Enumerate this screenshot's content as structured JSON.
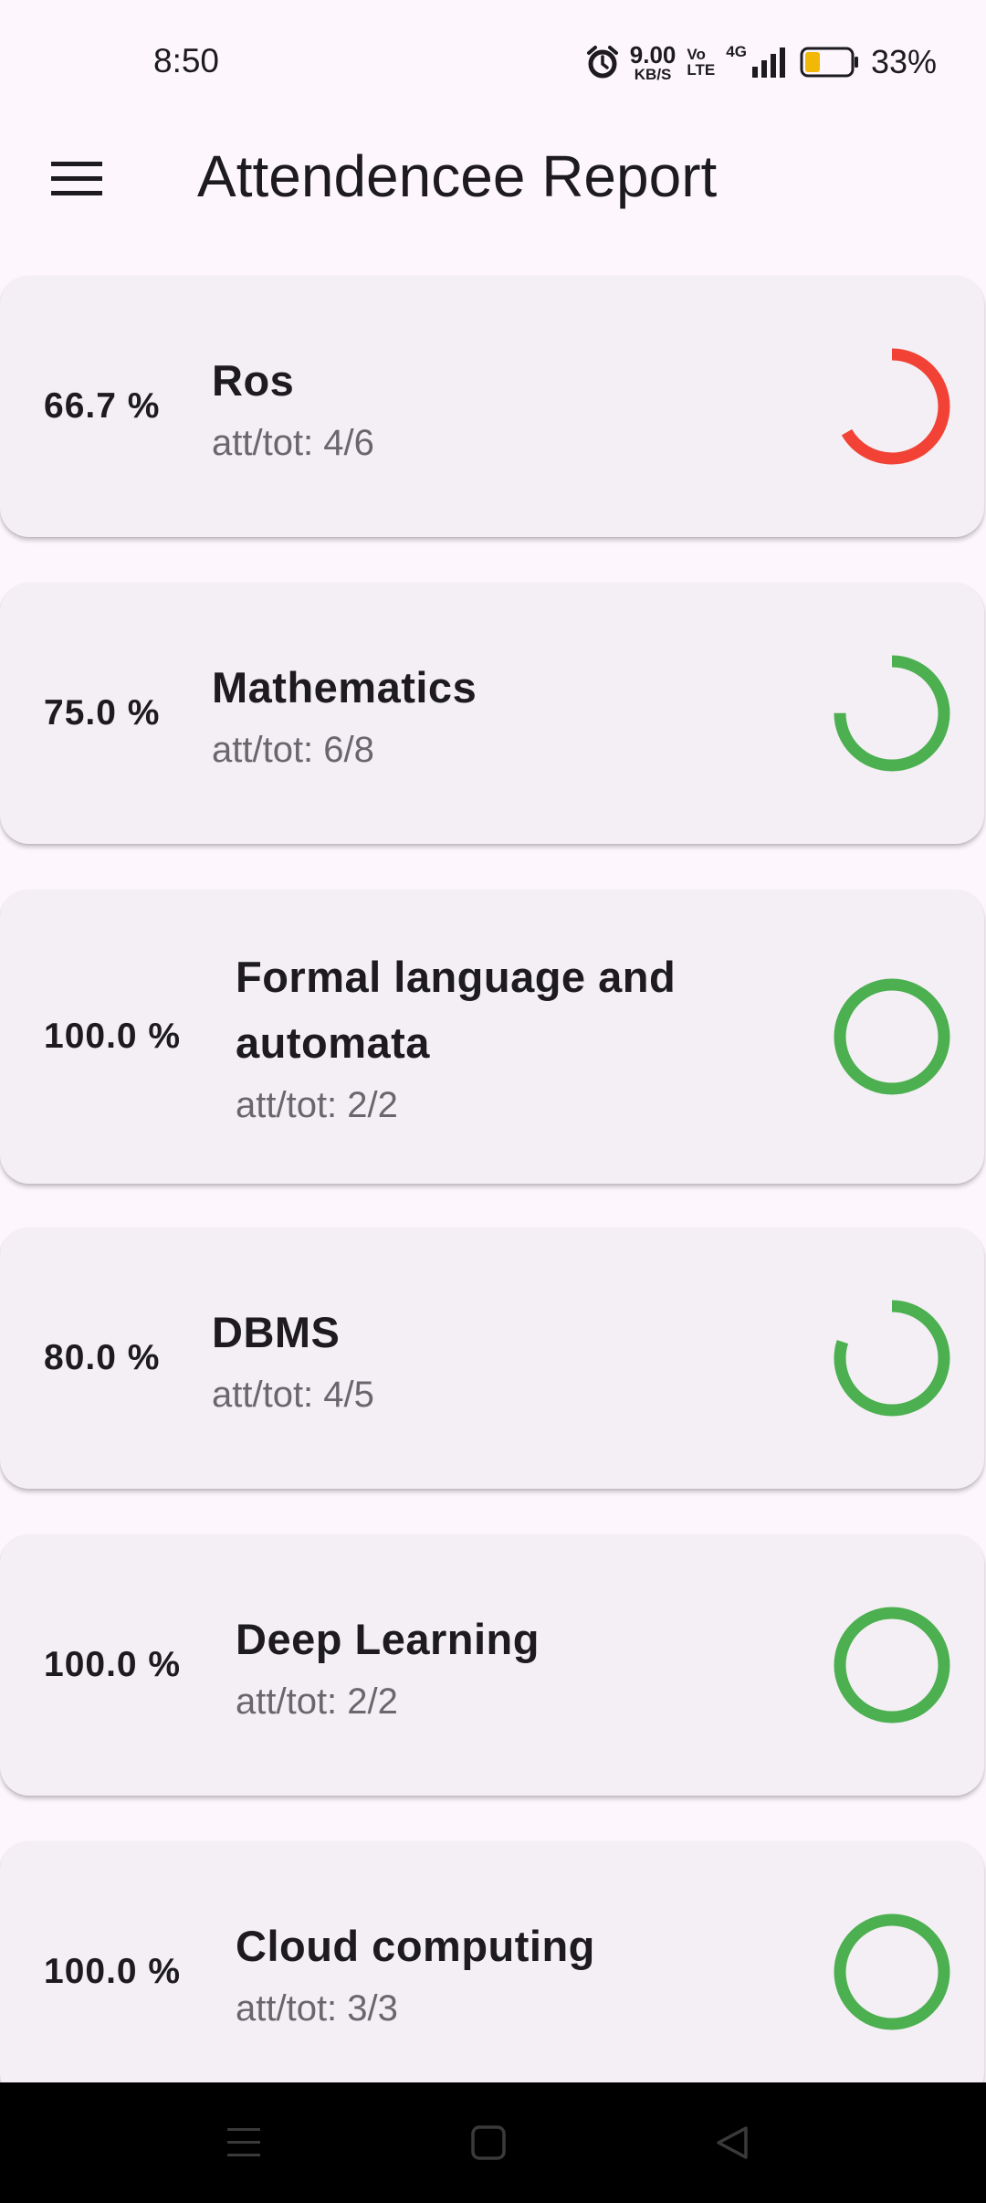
{
  "status_bar": {
    "time": "8:50",
    "net_speed_value": "9.00",
    "net_speed_unit": "KB/S",
    "volte_top": "Vo",
    "volte_bottom": "LTE",
    "network_type": "4G",
    "battery_percent": "33%",
    "battery_level": 0.33,
    "battery_color": "#f2b807"
  },
  "app_bar": {
    "title": "Attendencee Report",
    "menu_icon": "hamburger-menu-icon"
  },
  "colors": {
    "ring_low": "#f24236",
    "ring_ok": "#4caf50",
    "card_bg": "#f3eff4",
    "page_bg": "#fdf7fd"
  },
  "subjects": [
    {
      "percent_label": "66.7 %",
      "name": "Ros",
      "att_tot": "att/tot: 4/6",
      "attended": 4,
      "total": 6,
      "ring_color": "#f24236"
    },
    {
      "percent_label": "75.0 %",
      "name": "Mathematics",
      "att_tot": "att/tot: 6/8",
      "attended": 6,
      "total": 8,
      "ring_color": "#4caf50"
    },
    {
      "percent_label": "100.0 %",
      "name": "Formal language and automata",
      "att_tot": "att/tot: 2/2",
      "attended": 2,
      "total": 2,
      "ring_color": "#4caf50"
    },
    {
      "percent_label": "80.0 %",
      "name": "DBMS",
      "att_tot": "att/tot: 4/5",
      "attended": 4,
      "total": 5,
      "ring_color": "#4caf50"
    },
    {
      "percent_label": "100.0 %",
      "name": "Deep Learning",
      "att_tot": "att/tot: 2/2",
      "attended": 2,
      "total": 2,
      "ring_color": "#4caf50"
    },
    {
      "percent_label": "100.0 %",
      "name": "Cloud computing",
      "att_tot": "att/tot: 3/3",
      "attended": 3,
      "total": 3,
      "ring_color": "#4caf50"
    }
  ],
  "nav_bar": {
    "buttons": [
      "recents-menu-icon",
      "home-square-icon",
      "back-triangle-icon"
    ]
  }
}
